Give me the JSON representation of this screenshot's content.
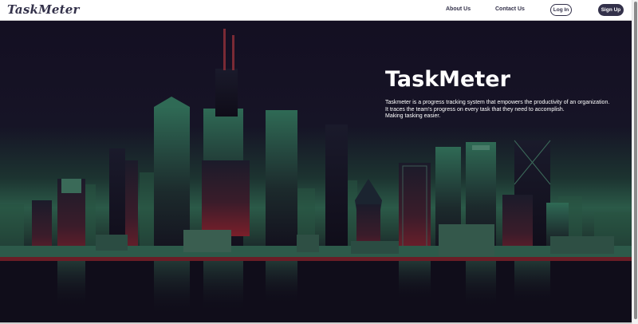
{
  "brand": {
    "logo_text": "TaskMeter"
  },
  "nav": {
    "about": "About Us",
    "contact": "Contact Us",
    "login": "Log In",
    "signup": "Sign Up"
  },
  "hero": {
    "title": "TaskMeter",
    "lines": [
      "Taskmeter is a progress tracking system that empowers the productivity of an organization.",
      "It traces the team's progress on every task that they need to accomplish.",
      "Making tasking easier."
    ]
  },
  "colors": {
    "brand": "#33314a",
    "sky": "#140f22",
    "city_green": "#2f6a55",
    "city_red": "#7a1f2a"
  }
}
